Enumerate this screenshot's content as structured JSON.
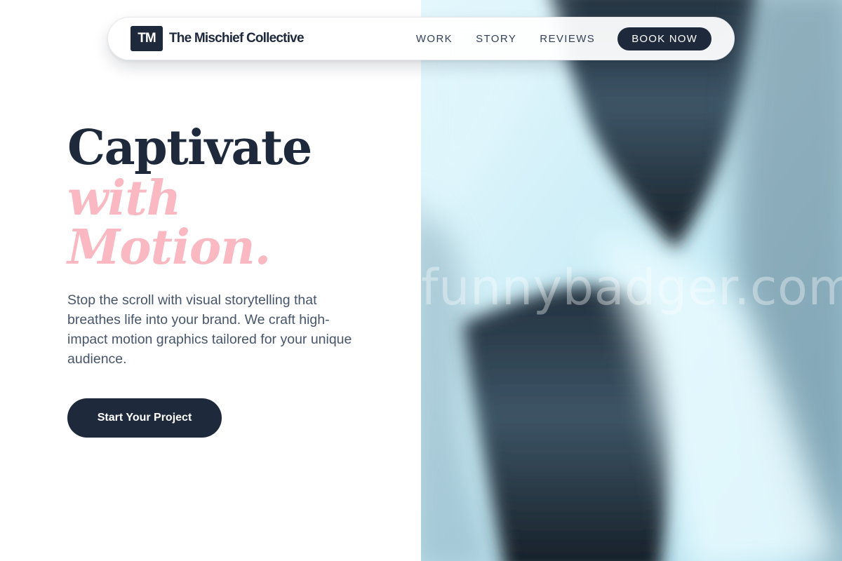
{
  "brand": {
    "mark": "TM",
    "name": "The Mischief Collective"
  },
  "nav": {
    "items": [
      {
        "label": "WORK"
      },
      {
        "label": "STORY"
      },
      {
        "label": "REVIEWS"
      }
    ],
    "cta_label": "BOOK NOW"
  },
  "hero": {
    "headline_line1": "Captivate",
    "headline_line2": "with",
    "headline_line3": "Motion.",
    "description": "Stop the scroll with visual storytelling that breathes life into your brand. We craft high-impact motion graphics tailored for your unique audience.",
    "cta_label": "Start Your Project",
    "watermark": "funnybadger.com"
  },
  "colors": {
    "primary_dark": "#1e293b",
    "accent_pink": "#f9b8c2",
    "body_text": "#475569",
    "visual_light": "#cfeef7"
  }
}
